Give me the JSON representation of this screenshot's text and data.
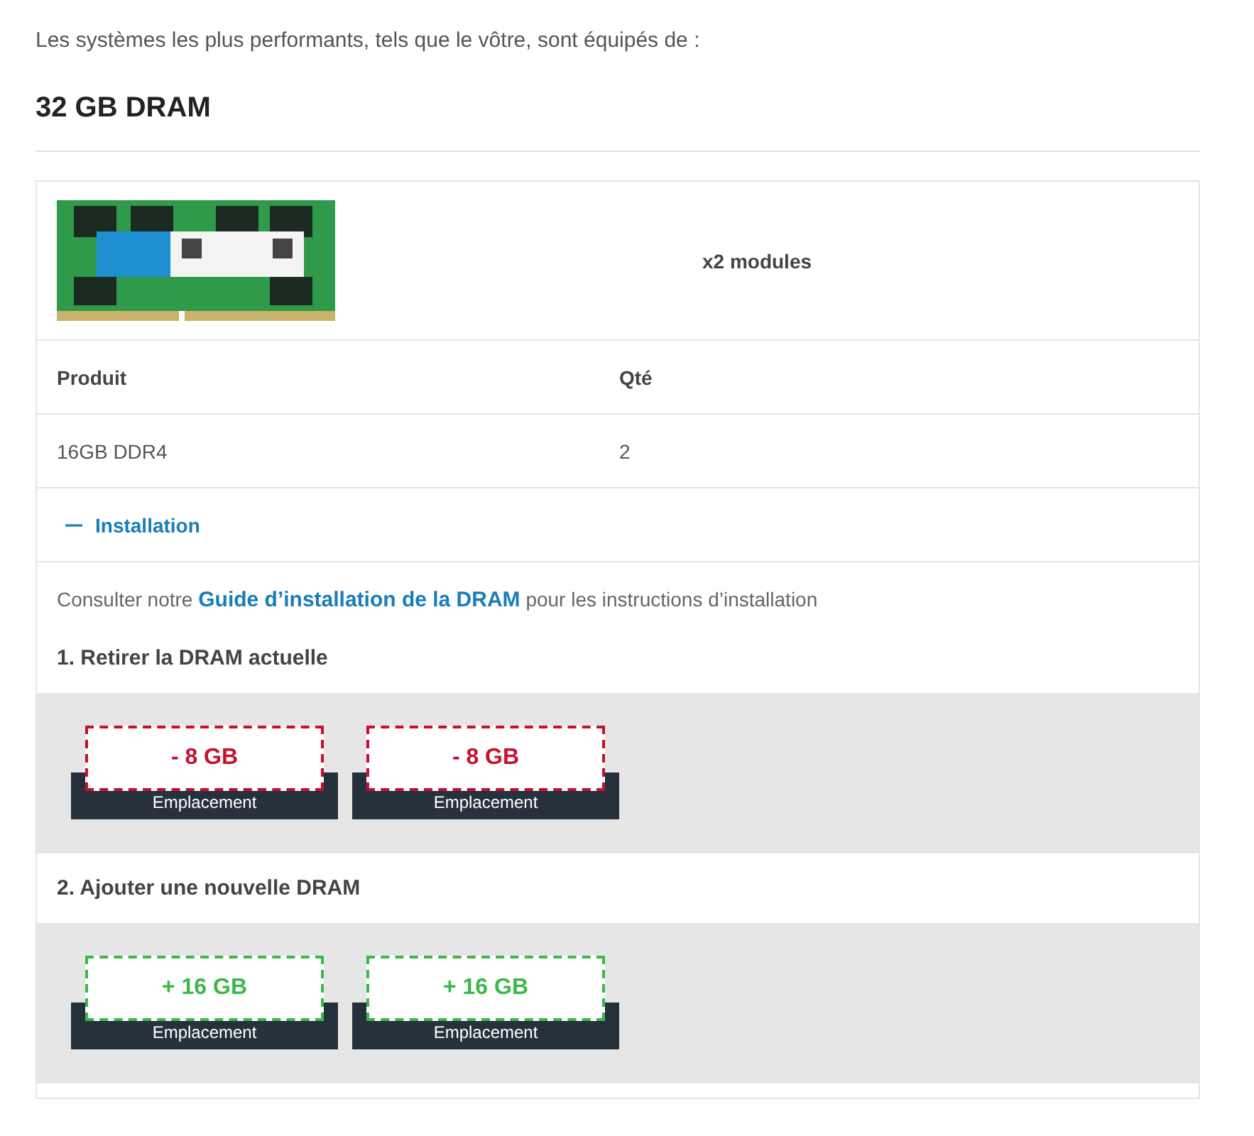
{
  "intro": "Les systèmes les plus performants, tels que le vôtre, sont équipés de :",
  "heading": "32 GB DRAM",
  "module": {
    "quantity": "x2 modules"
  },
  "table": {
    "columns": [
      "Produit",
      "Qté"
    ],
    "rows": [
      [
        "16GB DDR4",
        "2"
      ]
    ]
  },
  "installation": {
    "label": "Installation",
    "expanded": true,
    "guide": {
      "before": "Consulter notre",
      "link": "Guide d’installation de la DRAM",
      "after": "pour les instructions d’installation"
    },
    "steps": [
      {
        "title": "1. Retirer la DRAM actuelle",
        "slots": [
          {
            "kind": "remove",
            "amount": "- 8 GB",
            "slot_label": "Emplacement"
          },
          {
            "kind": "remove",
            "amount": "- 8 GB",
            "slot_label": "Emplacement"
          }
        ]
      },
      {
        "title": "2. Ajouter une nouvelle DRAM",
        "slots": [
          {
            "kind": "add",
            "amount": "+ 16 GB",
            "slot_label": "Emplacement"
          },
          {
            "kind": "add",
            "amount": "+ 16 GB",
            "slot_label": "Emplacement"
          }
        ]
      }
    ]
  }
}
